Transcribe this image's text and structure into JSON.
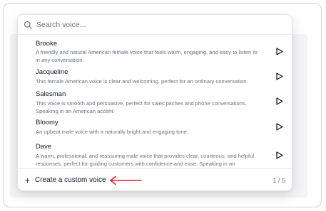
{
  "search": {
    "placeholder": "Search voice...",
    "icon": "search-icon"
  },
  "voices": [
    {
      "name": "Brooke",
      "description": "A friendly and natural American female voice that feels warm, engaging, and easy to listen to in any conversation."
    },
    {
      "name": "Jacqueline",
      "description": "This female American voice is clear and welcoming, perfect for an ordinary conversation."
    },
    {
      "name": "Salesman",
      "description": "This voice is smooth and persuasive, perfect for sales pitches and phone conversations. Speaking in an American accent."
    },
    {
      "name": "Bloomy",
      "description": "An upbeat male voice with a naturally bright and engaging tone."
    },
    {
      "name": "Dave",
      "description": "A warm, professional, and reassuring male voice that provides clear, courteous, and helpful responses, perfect for guiding customers with confidence and ease. Speaking in an American accent."
    }
  ],
  "footer": {
    "create_label": "Create a custom voice",
    "page_indicator": "1 / 5"
  },
  "colors": {
    "annotation_arrow": "#e11d2e",
    "text_primary": "#111827",
    "text_secondary": "#6b7280"
  }
}
